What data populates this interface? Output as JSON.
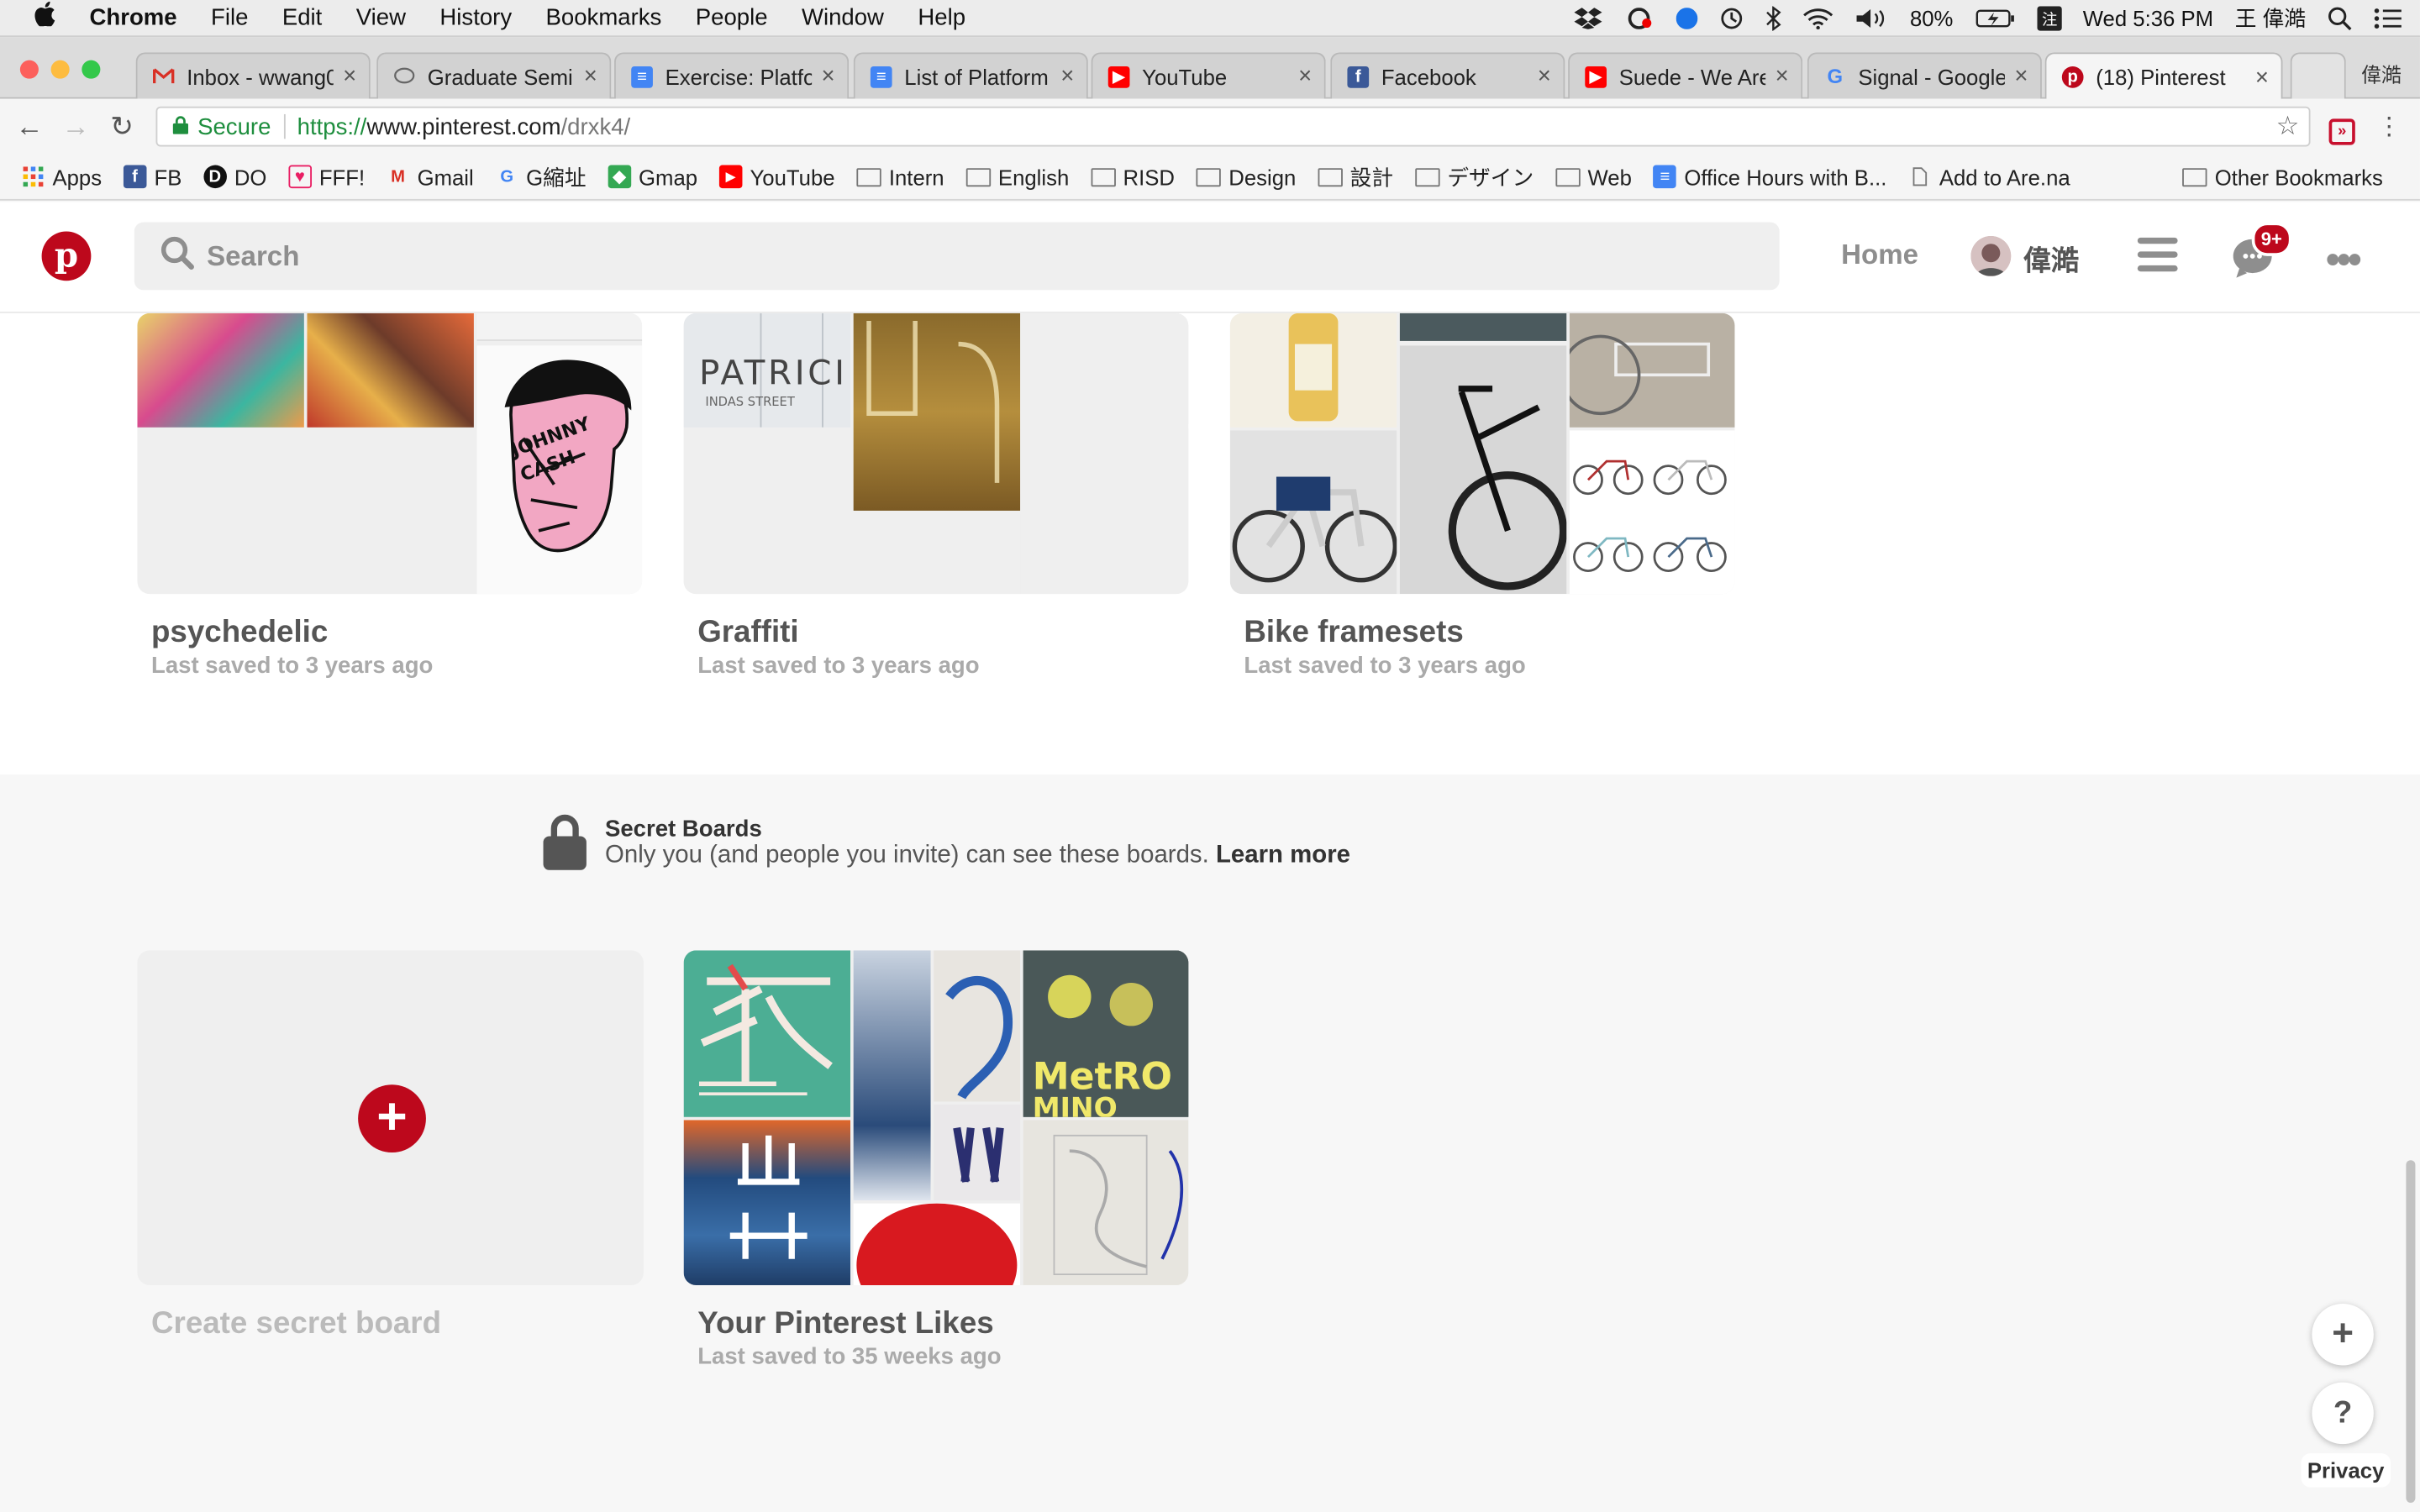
{
  "menubar": {
    "app": "Chrome",
    "items": [
      "File",
      "Edit",
      "View",
      "History",
      "Bookmarks",
      "People",
      "Window",
      "Help"
    ],
    "battery": "80%",
    "clock": "Wed 5:36 PM",
    "user": "王 偉澔"
  },
  "tabs": [
    {
      "title": "Inbox - wwang0",
      "icon": "gmail-icon",
      "color": "#d93025"
    },
    {
      "title": "Graduate Semin",
      "icon": "chat-icon",
      "color": "#666666"
    },
    {
      "title": "Exercise: Platfo",
      "icon": "docs-icon",
      "color": "#4285f4"
    },
    {
      "title": "List of Platform",
      "icon": "docs-icon",
      "color": "#4285f4"
    },
    {
      "title": "YouTube",
      "icon": "youtube-icon",
      "color": "#ff0000"
    },
    {
      "title": "Facebook",
      "icon": "facebook-icon",
      "color": "#3b5998"
    },
    {
      "title": "Suede - We Are",
      "icon": "youtube-icon",
      "color": "#ff0000"
    },
    {
      "title": "Signal - Google",
      "icon": "google-icon",
      "color": "#4285f4"
    },
    {
      "title": "(18) Pinterest",
      "icon": "pinterest-icon",
      "color": "#bd081c"
    }
  ],
  "window_profile": "偉澔",
  "address": {
    "secure": "Secure",
    "url_scheme": "https://",
    "url_host": "www.pinterest.com",
    "url_path": "/drxk4/"
  },
  "bookmarks": [
    {
      "label": "Apps",
      "icon": "apps-icon"
    },
    {
      "label": "FB",
      "icon": "facebook-icon"
    },
    {
      "label": "DO",
      "icon": "do-icon"
    },
    {
      "label": "FFF!",
      "icon": "fff-icon"
    },
    {
      "label": "Gmail",
      "icon": "gmail-icon"
    },
    {
      "label": "G縮址",
      "icon": "google-icon"
    },
    {
      "label": "Gmap",
      "icon": "maps-icon"
    },
    {
      "label": "YouTube",
      "icon": "youtube-icon"
    },
    {
      "label": "Intern",
      "icon": "folder-icon"
    },
    {
      "label": "English",
      "icon": "folder-icon"
    },
    {
      "label": "RISD",
      "icon": "folder-icon"
    },
    {
      "label": "Design",
      "icon": "folder-icon"
    },
    {
      "label": "設計",
      "icon": "folder-icon"
    },
    {
      "label": "デザイン",
      "icon": "folder-icon"
    },
    {
      "label": "Web",
      "icon": "folder-icon"
    },
    {
      "label": "Office Hours with B...",
      "icon": "docs-icon"
    },
    {
      "label": "Add to Are.na",
      "icon": "page-icon"
    }
  ],
  "other_bookmarks": "Other Bookmarks",
  "header": {
    "search_placeholder": "Search",
    "home": "Home",
    "username": "偉澔",
    "notifications": "9+"
  },
  "boards": [
    {
      "title": "psychedelic",
      "subtitle": "Last saved to 3 years ago"
    },
    {
      "title": "Graffiti",
      "subtitle": "Last saved to 3 years ago"
    },
    {
      "title": "Bike framesets",
      "subtitle": "Last saved to 3 years ago"
    }
  ],
  "secret": {
    "title": "Secret Boards",
    "description": "Only you (and people you invite) can see these boards.",
    "learn_more": "Learn more",
    "create_label": "Create secret board"
  },
  "likes_board": {
    "title": "Your Pinterest Likes",
    "subtitle": "Last saved to 35 weeks ago"
  },
  "fab": {
    "add": "+",
    "help": "?",
    "privacy": "Privacy"
  }
}
